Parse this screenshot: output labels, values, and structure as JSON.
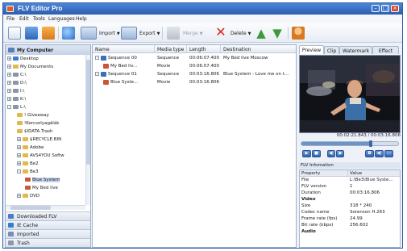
{
  "window": {
    "title": "FLV Editor Pro"
  },
  "menu": [
    "File",
    "Edit",
    "Tools",
    "Languages",
    "Help"
  ],
  "toolbar": {
    "import_label": "Import",
    "export_label": "Export",
    "merge_label": "Merge",
    "delete_label": "Delete"
  },
  "left": {
    "header": "My Computer",
    "tree": [
      {
        "label": "Desktop",
        "exp": "+"
      },
      {
        "label": "My Documents",
        "exp": "+"
      },
      {
        "label": "C:\\",
        "exp": "+"
      },
      {
        "label": "D:\\",
        "exp": "+"
      },
      {
        "label": "I:\\",
        "exp": "+"
      },
      {
        "label": "K:\\",
        "exp": "+"
      },
      {
        "label": "L:\\",
        "exp": "-"
      },
      {
        "label": "! Giveaway",
        "exp": ""
      },
      {
        "label": "!Korcsolyagálák",
        "exp": ""
      },
      {
        "label": "$IDATA.Trash",
        "exp": ""
      },
      {
        "label": "$RECYCLE.BIN",
        "exp": "+"
      },
      {
        "label": "Adobe",
        "exp": "+"
      },
      {
        "label": "AVS4YOU Softw",
        "exp": "+"
      },
      {
        "label": "Be2",
        "exp": "+"
      },
      {
        "label": "Be3",
        "exp": "-"
      },
      {
        "label": "Blue System",
        "exp": ""
      },
      {
        "label": "My Bed live",
        "exp": ""
      },
      {
        "label": "DVD",
        "exp": "+"
      }
    ],
    "sections": [
      "Downloaded FLV",
      "IE Cache",
      "Imported",
      "Trash"
    ]
  },
  "list": {
    "columns": [
      "Name",
      "Media type",
      "Length",
      "Destination"
    ],
    "rows": [
      {
        "name": "Sequence 00",
        "type": "Sequence",
        "length": "00:06:07.400",
        "dest": "My Bed live Moscow"
      },
      {
        "name": "My Bed liv...",
        "type": "Movie",
        "length": "00:06:07.400",
        "dest": ""
      },
      {
        "name": "Sequence 01",
        "type": "Sequence",
        "length": "00:03:16.806",
        "dest": "Blue System - Love me on t..."
      },
      {
        "name": "Blue Syste...",
        "type": "Movie",
        "length": "00:03:16.806",
        "dest": ""
      }
    ]
  },
  "right": {
    "tabs": [
      "Preview",
      "Clip",
      "Watermark",
      "Effect"
    ],
    "timecode": "00:02:21.843 / 00:03:16.806",
    "progress_fraction": 0.72,
    "info_title": "FLV Infomation",
    "prop_headers": [
      "Property",
      "Value"
    ],
    "props": [
      {
        "k": "File",
        "v": "L:\\Be3\\Blue Syste..."
      },
      {
        "k": "FLV version",
        "v": "1"
      },
      {
        "k": "Duration",
        "v": "00:03:16.806"
      },
      {
        "k": "Video",
        "v": "",
        "group": true
      },
      {
        "k": "Size",
        "v": "318 * 240"
      },
      {
        "k": "Codec name",
        "v": "Sorenson H.263"
      },
      {
        "k": "Frame rate (fps)",
        "v": "24.99"
      },
      {
        "k": "Bit rate (kbps)",
        "v": "256.602"
      },
      {
        "k": "Audio",
        "v": "",
        "group": true
      }
    ]
  },
  "colors": {
    "titlebar": "#2b5cb0",
    "selection": "#c7d6ee",
    "accent": "#3d68a8"
  }
}
